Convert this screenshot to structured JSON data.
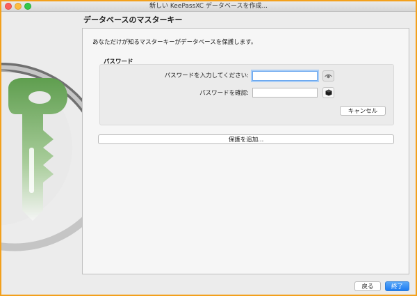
{
  "window": {
    "title": "新しい KeePassXC データベースを作成..."
  },
  "page": {
    "title": "データベースのマスターキー",
    "description": "あなただけが知るマスターキーがデータベースを保護します。"
  },
  "password_group": {
    "title": "パスワード",
    "password_label": "パスワードを入力してください:",
    "password_value": "",
    "confirm_label": "パスワードを確認:",
    "confirm_value": "",
    "toggle_icon": "eye-icon",
    "generator_icon": "dice-icon",
    "cancel_label": "キャンセル"
  },
  "add_protection_label": "保護を追加...",
  "footer": {
    "back_label": "戻る",
    "finish_label": "終了"
  },
  "colors": {
    "background_border": "#f3a01c",
    "accent_blue": "#1e7cf2",
    "logo_green": "#6aaa5a"
  }
}
